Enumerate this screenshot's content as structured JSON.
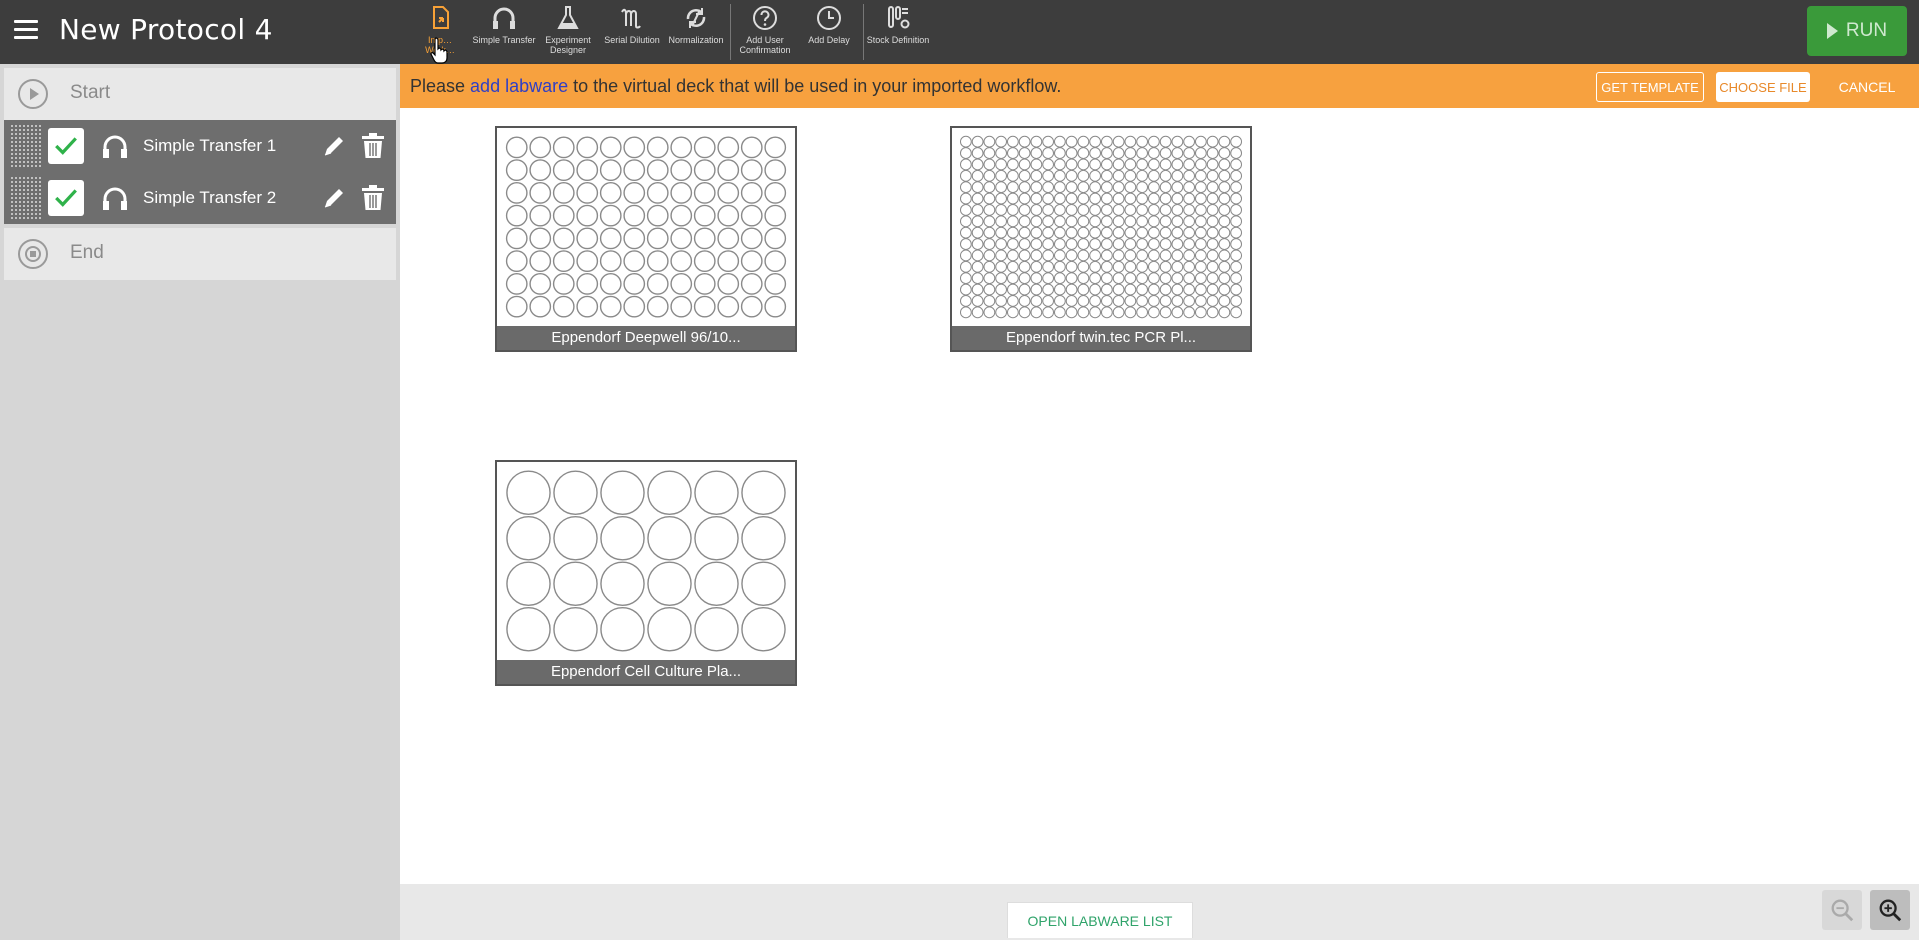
{
  "header": {
    "title": "New Protocol 4",
    "tools": [
      {
        "label": "Import Workflow",
        "display": "Imp…\nWork…",
        "icon": "import-workflow-icon",
        "active": true
      },
      {
        "label": "Simple Transfer",
        "icon": "simple-transfer-icon"
      },
      {
        "label": "Experiment Designer",
        "icon": "experiment-designer-icon"
      },
      {
        "label": "Serial Dilution",
        "icon": "serial-dilution-icon"
      },
      {
        "label": "Normalization",
        "icon": "normalization-icon"
      },
      {
        "label": "Add User Confirmation",
        "icon": "question-icon"
      },
      {
        "label": "Add Delay",
        "icon": "clock-icon"
      },
      {
        "label": "Stock Definition",
        "icon": "stock-definition-icon"
      }
    ],
    "run_label": "RUN"
  },
  "sidebar": {
    "start_label": "Start",
    "end_label": "End",
    "steps": [
      {
        "label": "Simple Transfer 1",
        "checked": true
      },
      {
        "label": "Simple Transfer 2",
        "checked": true
      }
    ]
  },
  "banner": {
    "prefix": "Please ",
    "link": "add labware",
    "suffix": " to the virtual deck that will be used in your imported workflow.",
    "get_template": "GET TEMPLATE",
    "choose_file": "CHOOSE FILE",
    "cancel": "CANCEL"
  },
  "deck": {
    "plates": [
      {
        "label": "Eppendorf Deepwell 96/10...",
        "rows": 8,
        "cols": 12
      },
      {
        "label": "Eppendorf twin.tec PCR Pl...",
        "rows": 16,
        "cols": 24
      },
      {
        "label": "Eppendorf Cell Culture Pla...",
        "rows": 4,
        "cols": 6
      }
    ]
  },
  "footer": {
    "open_labware_list": "OPEN LABWARE LIST"
  },
  "colors": {
    "topbar": "#3d3d3d",
    "accent_orange": "#f7a13f",
    "run_green": "#3a9a3a",
    "link_blue": "#2f3fc6",
    "list_green": "#2fa36a"
  }
}
